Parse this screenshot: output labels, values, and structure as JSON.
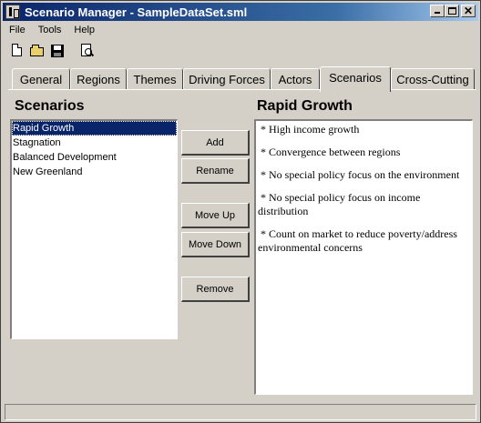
{
  "window": {
    "title": "Scenario Manager - SampleDataSet.sml",
    "minimize_icon": "minimize-icon",
    "maximize_icon": "maximize-icon",
    "close_glyph": "✕"
  },
  "menubar": {
    "items": [
      "File",
      "Tools",
      "Help"
    ]
  },
  "toolbar": {
    "icons": [
      "new-document-icon",
      "open-folder-icon",
      "save-icon",
      "print-preview-icon"
    ]
  },
  "tabs": {
    "items": [
      "General",
      "Regions",
      "Themes",
      "Driving Forces",
      "Actors",
      "Scenarios",
      "Cross-Cutting"
    ],
    "active": "Scenarios"
  },
  "scenarios_panel": {
    "title": "Scenarios",
    "items": [
      "Rapid Growth",
      "Stagnation",
      "Balanced Development",
      "New Greenland"
    ],
    "selected": "Rapid Growth"
  },
  "buttons": {
    "add": "Add",
    "rename": "Rename",
    "move_up": "Move Up",
    "move_down": "Move Down",
    "remove": "Remove"
  },
  "detail_panel": {
    "title": "Rapid Growth",
    "paragraphs": [
      " * High income growth",
      " * Convergence between regions",
      " * No special policy focus on the environment",
      " * No special policy focus on income distribution",
      " * Count on market to reduce poverty/address environmental concerns"
    ]
  },
  "statusbar": {
    "text": ""
  }
}
